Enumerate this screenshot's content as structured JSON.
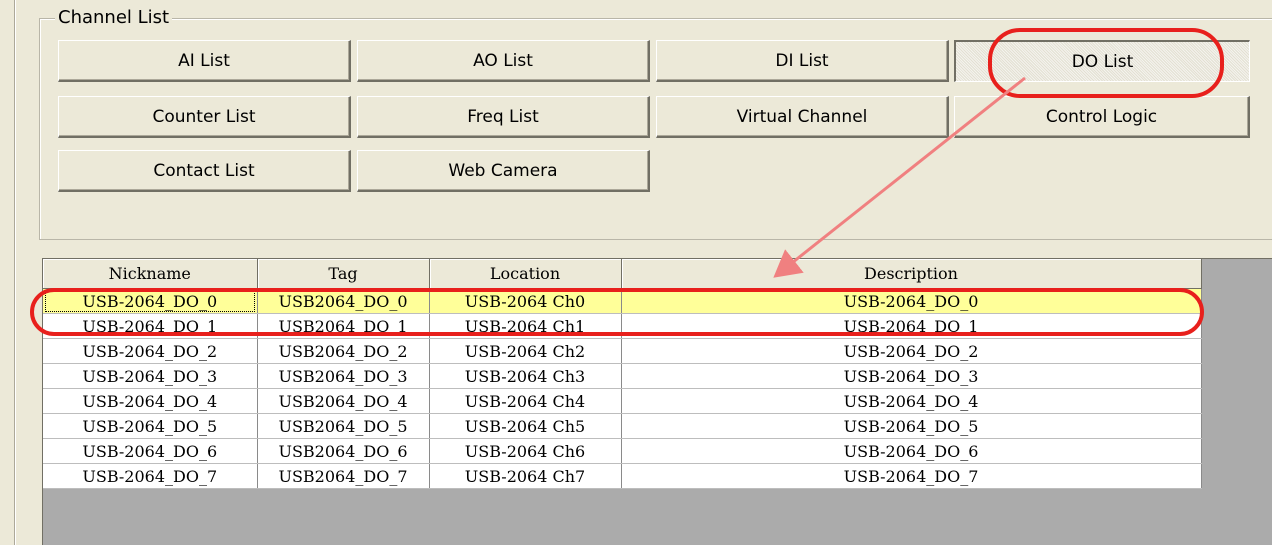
{
  "group_title": "Channel List",
  "buttons": [
    {
      "label": "AI List"
    },
    {
      "label": "AO List"
    },
    {
      "label": "DI List"
    },
    {
      "label": "DO List"
    },
    {
      "label": "Counter List"
    },
    {
      "label": "Freq List"
    },
    {
      "label": "Virtual Channel"
    },
    {
      "label": "Control Logic"
    },
    {
      "label": "Contact List"
    },
    {
      "label": "Web Camera"
    }
  ],
  "active_button": "DO List",
  "table": {
    "columns": [
      "Nickname",
      "Tag",
      "Location",
      "Description"
    ],
    "rows": [
      [
        "USB-2064_DO_0",
        "USB2064_DO_0",
        "USB-2064 Ch0",
        "USB-2064_DO_0"
      ],
      [
        "USB-2064_DO_1",
        "USB2064_DO_1",
        "USB-2064 Ch1",
        "USB-2064_DO_1"
      ],
      [
        "USB-2064_DO_2",
        "USB2064_DO_2",
        "USB-2064 Ch2",
        "USB-2064_DO_2"
      ],
      [
        "USB-2064_DO_3",
        "USB2064_DO_3",
        "USB-2064 Ch3",
        "USB-2064_DO_3"
      ],
      [
        "USB-2064_DO_4",
        "USB2064_DO_4",
        "USB-2064 Ch4",
        "USB-2064_DO_4"
      ],
      [
        "USB-2064_DO_5",
        "USB2064_DO_5",
        "USB-2064 Ch5",
        "USB-2064_DO_5"
      ],
      [
        "USB-2064_DO_6",
        "USB2064_DO_6",
        "USB-2064 Ch6",
        "USB-2064_DO_6"
      ],
      [
        "USB-2064_DO_7",
        "USB2064_DO_7",
        "USB-2064 Ch7",
        "USB-2064_DO_7"
      ]
    ],
    "selected_row": 0
  },
  "colors": {
    "panel": "#ece9d8",
    "selected_row": "#ffff99",
    "annotation": "#e8201c",
    "arrow": "#f08080"
  }
}
